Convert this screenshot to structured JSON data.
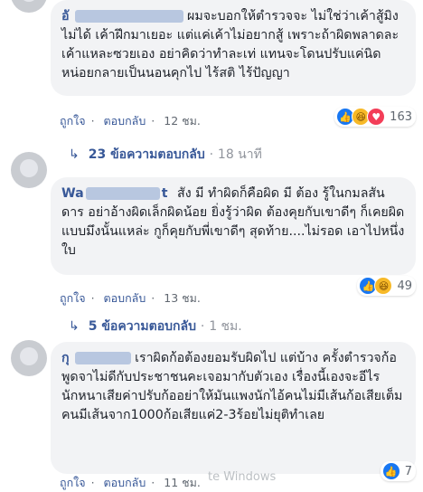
{
  "comments": [
    {
      "name": "อั",
      "text_line1": "ผมจะบอกให้ตำรวจจะ",
      "text_rest": "ไม่ใช่ว่าเค้าสู้มิงไม่ได้ เค้าฝึกมาเยอะ แต่แค่เค้าไม่อยากสู้ เพราะถ้าผิดพลาดละเค้าแหละซวยเอง อย่าคิดว่าทำละเท่ แทนจะโดนปรับแค่นิดหน่อยกลายเป็นนอนคุกไป ไร้สติ ไร้ปัญญา",
      "like_label": "ถูกใจ",
      "reply_label": "ตอบกลับ",
      "time": "12 ชม.",
      "reactions": "163",
      "replies_label": "23 ข้อความตอบกลับ",
      "replies_time": "18 นาที"
    },
    {
      "name": "Wa",
      "name_tail": "t",
      "text_line1": "สัง มี ทำผิดก็คือผิด มี ต้อง",
      "text_rest": "รู้ในกมลสันดาร อย่าอ้างผิดเล็กผิดน้อย ยิ่งรู้ว่าผิด ต้องคุยกับเขาดีๆ ก็เคยผิดแบบมึงนั้นแหล่ะ กูก็คุยกับพี่เขาดีๆ สุดท้าย....ไม่รอด เอาไปหนึ่งใบ",
      "like_label": "ถูกใจ",
      "reply_label": "ตอบกลับ",
      "time": "13 ชม.",
      "reactions": "49",
      "replies_label": "5 ข้อความตอบกลับ",
      "replies_time": "1 ชม."
    },
    {
      "name": "กุ",
      "text_line1": "เราผิดก้อต้องยอมรับผิดไป แต่บ้าง",
      "text_rest": "ครั้งตำรวจก้อพูดจาไม่ดีกับประชาชนคะเจอมากับตัวเอง เรื่องนี้เองจะอีไรนักหนาเสียค่าปรับก้ออย่าให้มันแพงนักไอ้คนไม่มีเส้นก้อเสียเต็มคนมีเส้นจาก1000ก้อเสียแค่2-3ร้อยไม่ยุติทำเลย",
      "like_label": "ถูกใจ",
      "reply_label": "ตอบกลับ",
      "time": "11 ชม.",
      "reactions": "7"
    }
  ],
  "separator": "·",
  "reply_arrow": "↳",
  "watermark": "te Windows"
}
